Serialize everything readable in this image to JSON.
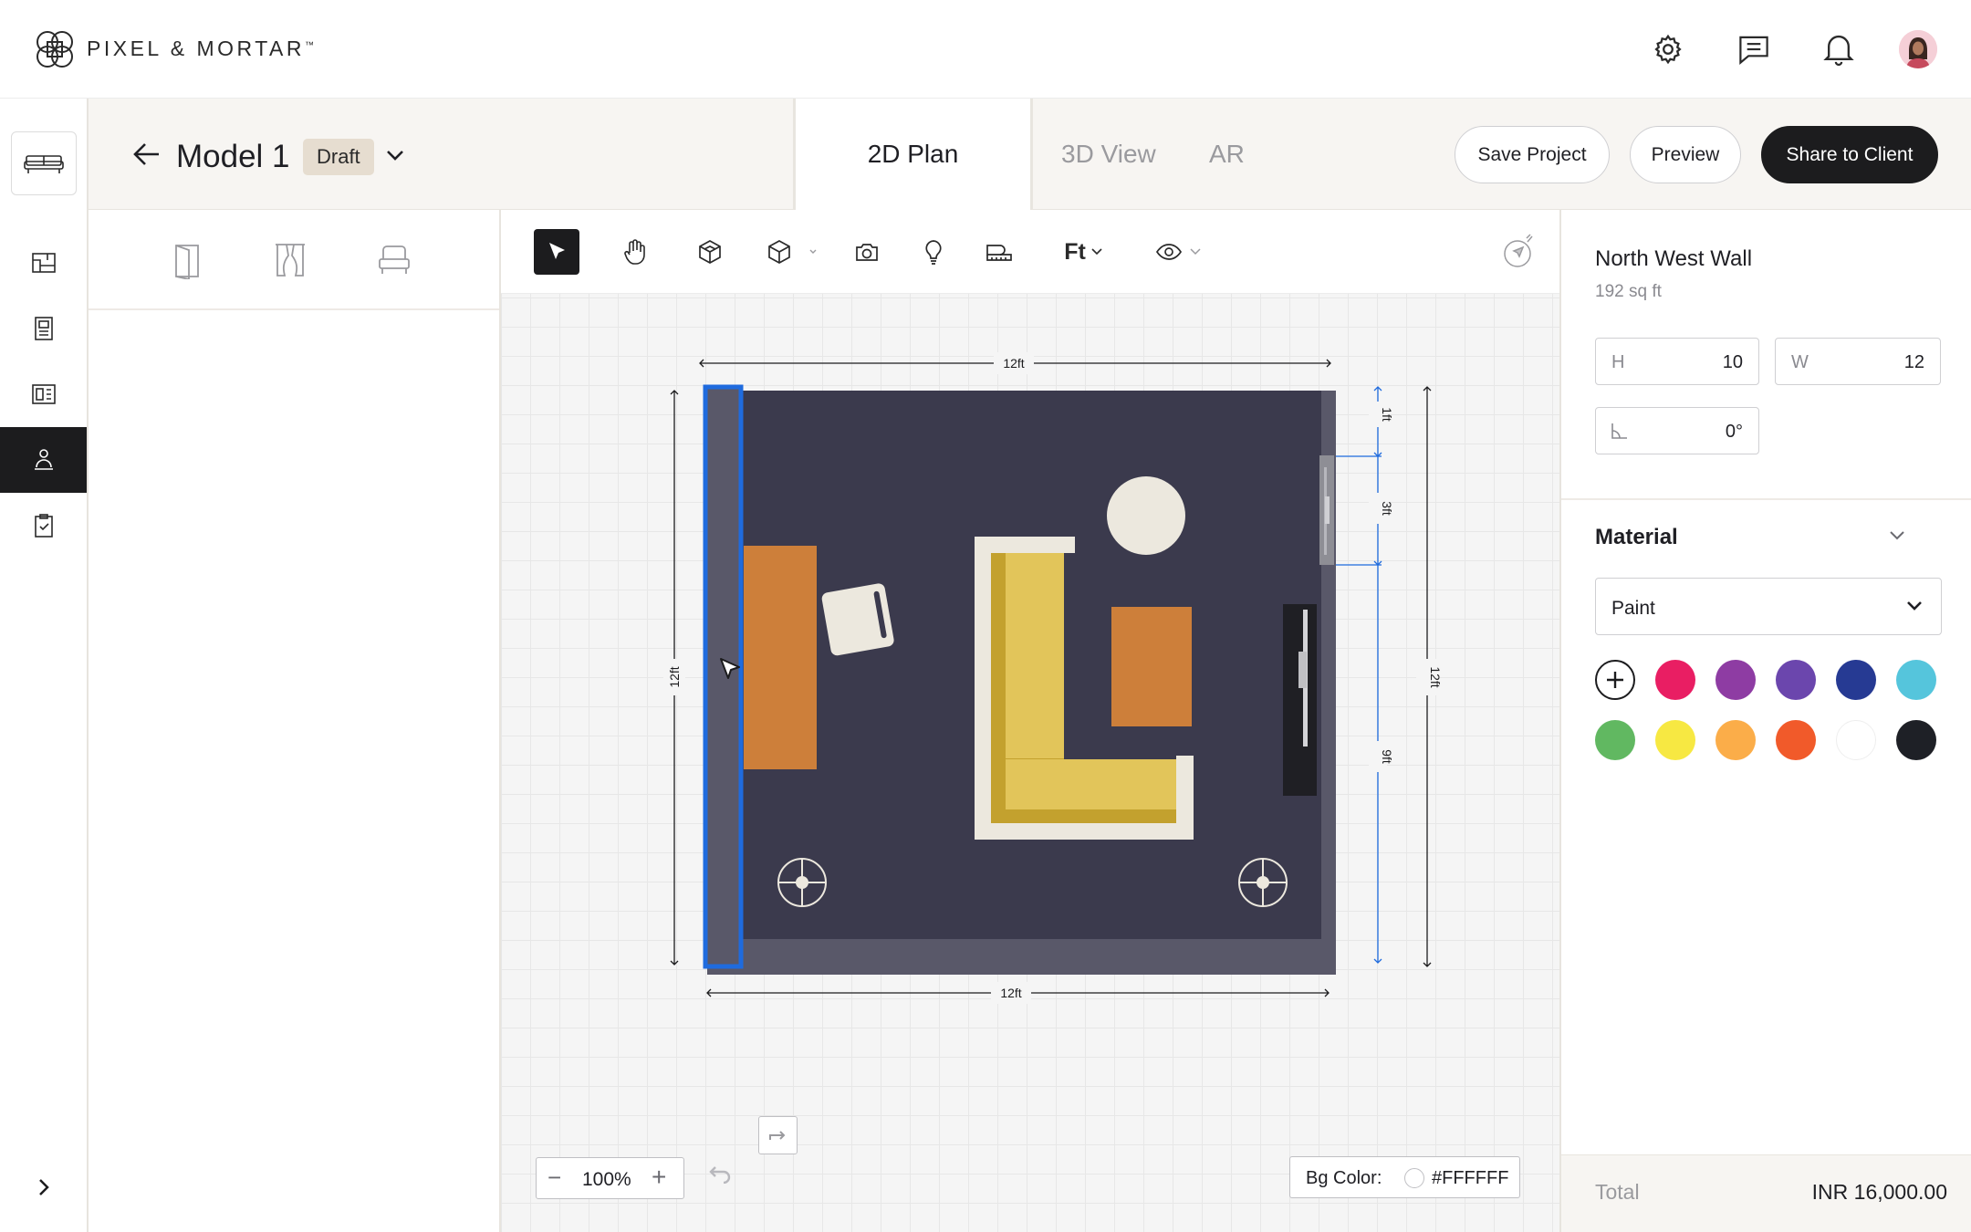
{
  "brand": {
    "name": "PIXEL & MORTAR",
    "tm": "™"
  },
  "header": {
    "icons": [
      "gear-icon",
      "chat-icon",
      "bell-icon"
    ]
  },
  "project": {
    "back_icon": "arrow-left-icon",
    "title": "Model 1",
    "status": "Draft"
  },
  "view_tabs": [
    {
      "label": "2D Plan",
      "active": true
    },
    {
      "label": "3D View",
      "active": false
    },
    {
      "label": "AR",
      "active": false
    }
  ],
  "actions": {
    "save": "Save Project",
    "preview": "Preview",
    "share": "Share to Client"
  },
  "left_rail": {
    "items": [
      "sofa-icon",
      "floorplan-icon",
      "catalog-icon",
      "layout-icon",
      "designer-icon",
      "checklist-icon"
    ],
    "active": "designer-icon",
    "expand_icon": "chevron-right-icon"
  },
  "library_tabs": [
    "door-icon",
    "curtain-icon",
    "armchair-icon"
  ],
  "toolbar": {
    "tools": [
      "select-icon",
      "pan-icon",
      "wall-icon",
      "cube-icon",
      "camera-icon",
      "bulb-icon",
      "measure-icon"
    ],
    "unit": "Ft",
    "visibility_icon": "eye-icon",
    "compass_icon": "compass-icon"
  },
  "plan": {
    "dimensions": {
      "top": "12ft",
      "bottom": "12ft",
      "left": "12ft",
      "right": "12ft"
    },
    "window_segments": {
      "top": "1ft",
      "window": "3ft",
      "bottom": "9ft"
    },
    "colors": {
      "floor": "#3b3a4d",
      "wall": "#595869",
      "selection": "#1f6bde",
      "sofa": "#e2c55a",
      "sofa_dark": "#c3a12e",
      "sofa_back": "#ece8de",
      "table": "#cd7f3a"
    }
  },
  "zoom": {
    "value": "100%",
    "minus": "−",
    "plus": "+"
  },
  "bg_color": {
    "label": "Bg Color:",
    "value": "#FFFFFF"
  },
  "properties": {
    "name": "North West Wall",
    "area": "192 sq ft",
    "height_label": "H",
    "height_value": "10",
    "width_label": "W",
    "width_value": "12",
    "angle_value": "0°"
  },
  "material": {
    "title": "Material",
    "type": "Paint",
    "swatches": [
      "#e91e63",
      "#8e3ca3",
      "#6b46ad",
      "#263a93",
      "#55c5dc",
      "#61b861",
      "#f7e842",
      "#fbad49",
      "#f15a2a",
      "#ffffff",
      "#1e2026"
    ]
  },
  "footer": {
    "total_label": "Total",
    "total_value": "INR 16,000.00"
  }
}
